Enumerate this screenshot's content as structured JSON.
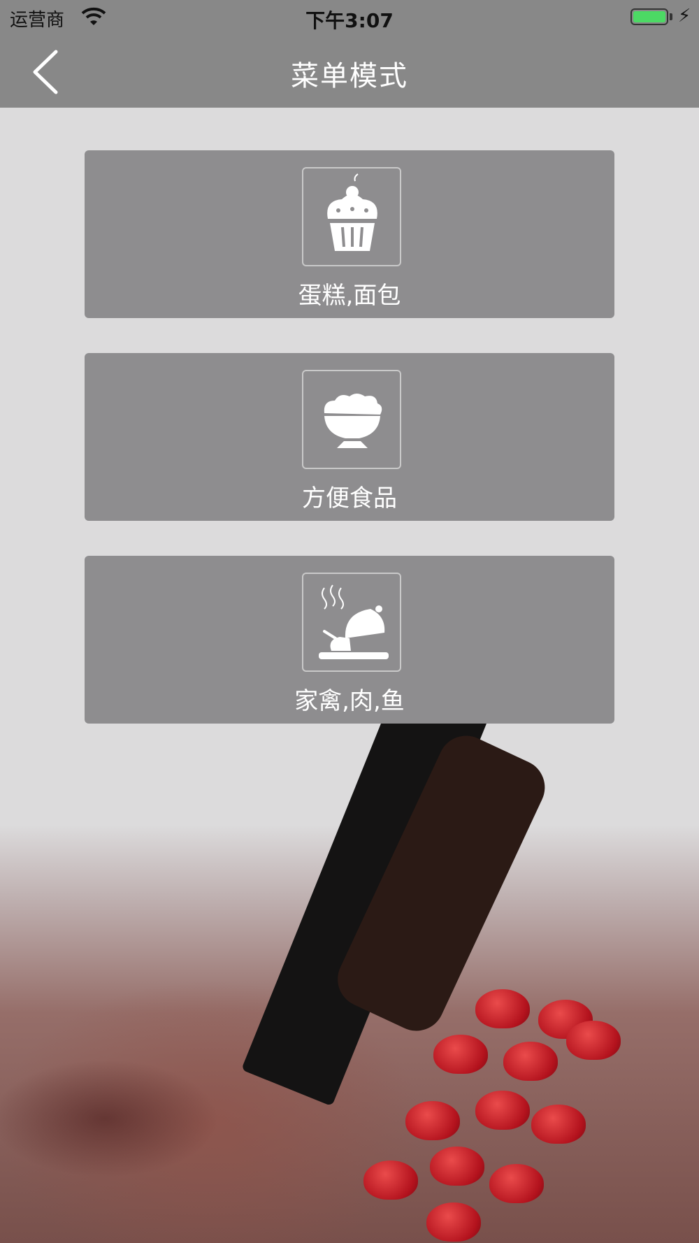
{
  "status_bar": {
    "carrier": "运营商",
    "time": "下午3:07"
  },
  "nav": {
    "title": "菜单模式"
  },
  "menu": [
    {
      "label": "蛋糕,面包",
      "icon": "cupcake-icon"
    },
    {
      "label": "方便食品",
      "icon": "bowl-icon"
    },
    {
      "label": "家禽,肉,鱼",
      "icon": "cloche-icon"
    }
  ],
  "colors": {
    "bar": "#888888",
    "card": "#8e8d8f",
    "page_bg": "#dcdbdc",
    "battery": "#4cd964"
  }
}
